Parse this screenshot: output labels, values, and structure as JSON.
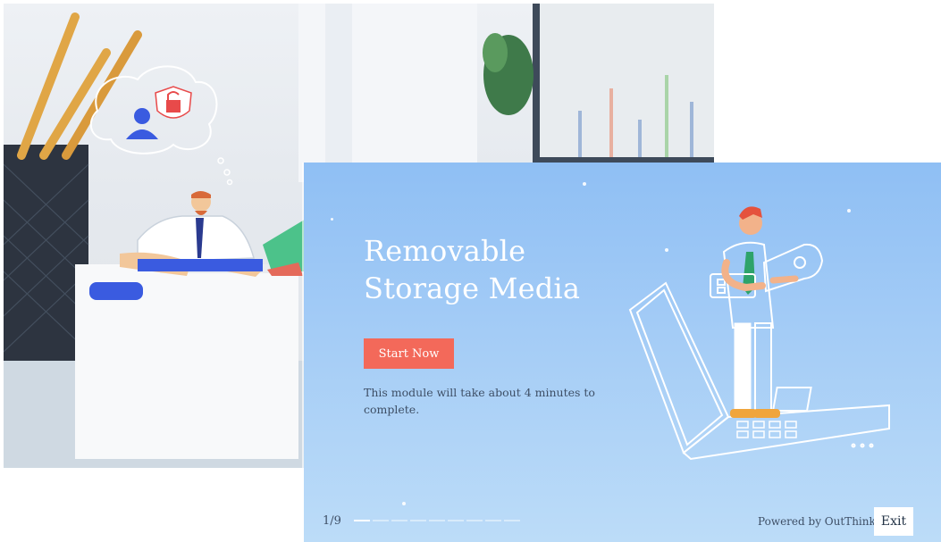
{
  "slide": {
    "title": "Removable Storage Media",
    "start_label": "Start Now",
    "duration_text": "This module will take about 4 minutes to complete.",
    "progress": {
      "label": "1/9",
      "current": 1,
      "total": 9
    },
    "powered_by": "Powered by OutThink",
    "exit_label": "Exit"
  },
  "colors": {
    "start_button": "#f3695a",
    "slide_gradient_top": "#8fbff4",
    "slide_gradient_bottom": "#bcdcf8",
    "text_dark": "#3e4f66",
    "security_shield": "#e84a4a",
    "figure_accent": "#3a5be0"
  },
  "icons": {
    "background_scene": "office-desk-photo",
    "thought_bubble": "headset-user-and-lock-icon",
    "slide_illustration": "man-holding-usb-drive-on-laptop"
  }
}
